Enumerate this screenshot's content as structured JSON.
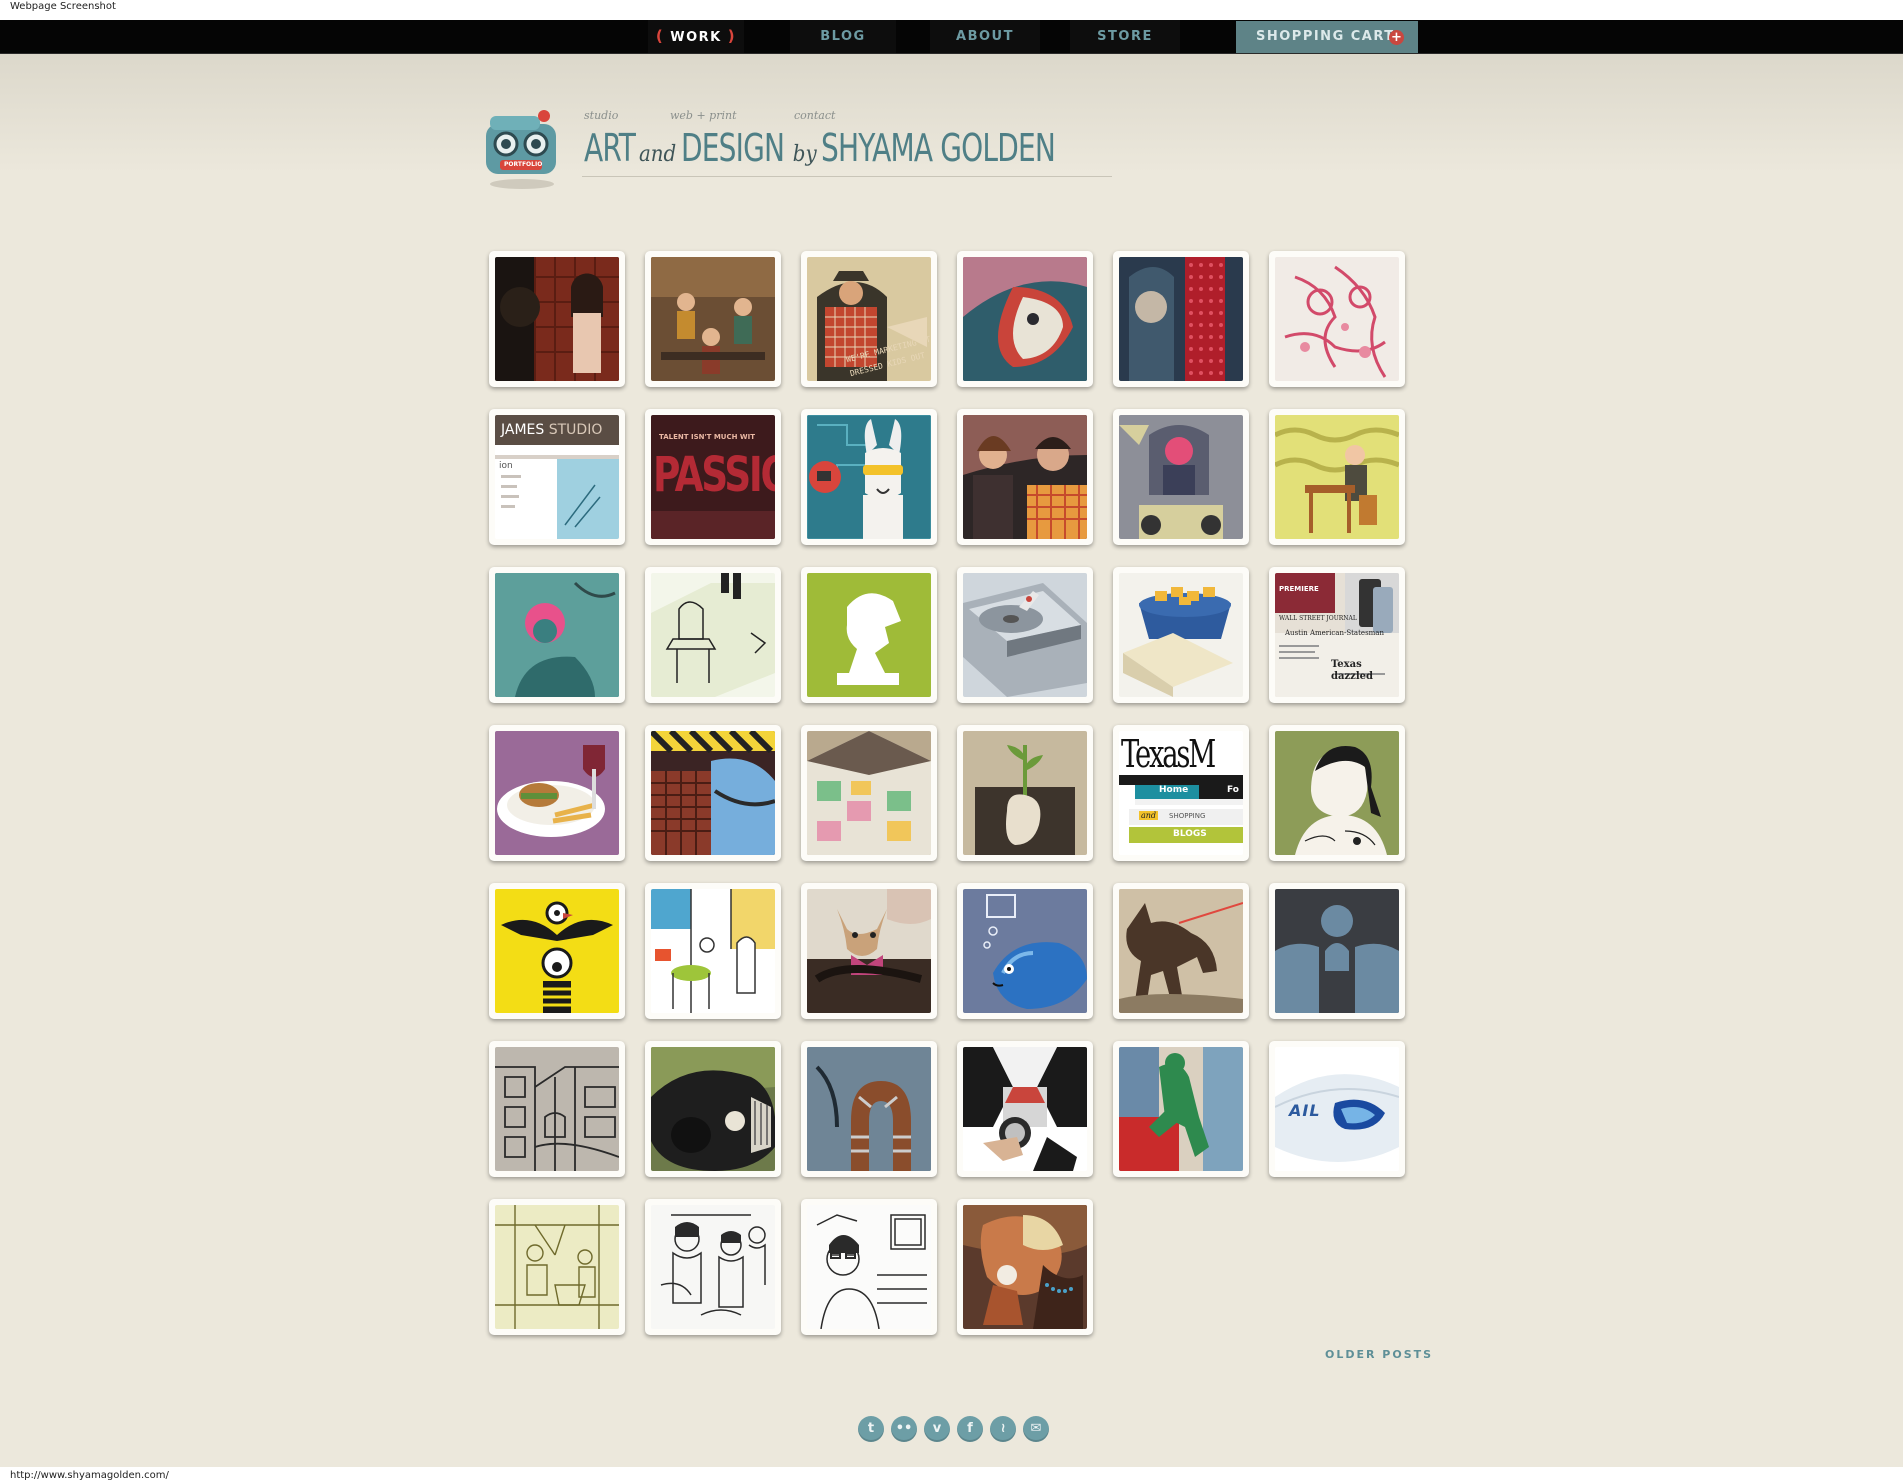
{
  "window": {
    "caption": "Webpage Screenshot",
    "status_url": "http://www.shyamagolden.com/"
  },
  "nav": {
    "items": [
      {
        "label": "WORK",
        "active": true
      },
      {
        "label": "BLOG",
        "active": false
      },
      {
        "label": "ABOUT",
        "active": false
      },
      {
        "label": "STORE",
        "active": false
      }
    ],
    "active_left_paren": "(",
    "active_right_paren": ")",
    "cart_label": "SHOPPING CART",
    "cart_icon": "plus-icon"
  },
  "logo": {
    "badge_text": "PORTFOLIO",
    "small_labels": {
      "studio": "studio",
      "web_print": "web + print",
      "contact": "contact"
    },
    "word_art": "ART",
    "word_and": "and",
    "word_design": "DESIGN",
    "word_by": "by",
    "word_name": "SHYAMA GOLDEN"
  },
  "tiles": [
    {
      "text": ""
    },
    {
      "text": ""
    },
    {
      "text": "WE'RE MARKETING IT"
    },
    {
      "text": ""
    },
    {
      "text": ""
    },
    {
      "text": ""
    },
    {
      "text": "JAMES STUDIO"
    },
    {
      "text": "PASSION"
    },
    {
      "text": ""
    },
    {
      "text": ""
    },
    {
      "text": ""
    },
    {
      "text": ""
    },
    {
      "text": ""
    },
    {
      "text": ""
    },
    {
      "text": ""
    },
    {
      "text": ""
    },
    {
      "text": ""
    },
    {
      "text": "Austin American-Statesman"
    },
    {
      "text": ""
    },
    {
      "text": ""
    },
    {
      "text": ""
    },
    {
      "text": ""
    },
    {
      "text": "Texas"
    },
    {
      "text": ""
    },
    {
      "text": ""
    },
    {
      "text": ""
    },
    {
      "text": ""
    },
    {
      "text": ""
    },
    {
      "text": ""
    },
    {
      "text": ""
    },
    {
      "text": ""
    },
    {
      "text": ""
    },
    {
      "text": ""
    },
    {
      "text": ""
    },
    {
      "text": ""
    },
    {
      "text": "AIL"
    },
    {
      "text": ""
    },
    {
      "text": ""
    },
    {
      "text": ""
    },
    {
      "text": ""
    }
  ],
  "tile_texts": {
    "t2_caption": "WE'RE MARKETING IT",
    "t2_caption2": "DRESSED KIDS OUT",
    "t6_header_a": "JAMES",
    "t6_header_b": "STUDIO",
    "t6_side": "ion",
    "t7_top": "TALENT ISN'T MUCH WIT",
    "t7_big": "PASSIO",
    "t17_paper": "Austin American-Statesman",
    "t17_a": "PREMIERE",
    "t17_b": "WALL STREET JOURNAL",
    "t17_c": "Texas",
    "t17_d": "dazzled",
    "t22_logo": "TexasM",
    "t22_home": "Home",
    "t22_fo": "Fo",
    "t22_and": "and",
    "t22_shop": "SHOPPING",
    "t22_blogs": "BLOGS",
    "t35_text": "AIL"
  },
  "older_posts": "OLDER POSTS",
  "social": [
    {
      "icon": "twitter-icon",
      "glyph": "t"
    },
    {
      "icon": "flickr-icon",
      "glyph": "••"
    },
    {
      "icon": "vimeo-icon",
      "glyph": "v"
    },
    {
      "icon": "facebook-icon",
      "glyph": "f"
    },
    {
      "icon": "rss-icon",
      "glyph": "≀"
    },
    {
      "icon": "email-icon",
      "glyph": "✉"
    }
  ],
  "colors": {
    "background": "#ece8dc",
    "nav_bg": "#050505",
    "nav_text": "#6d9ba3",
    "accent_red": "#d9453c",
    "teal": "#4f7f86",
    "cart_bg": "#5e8387"
  }
}
